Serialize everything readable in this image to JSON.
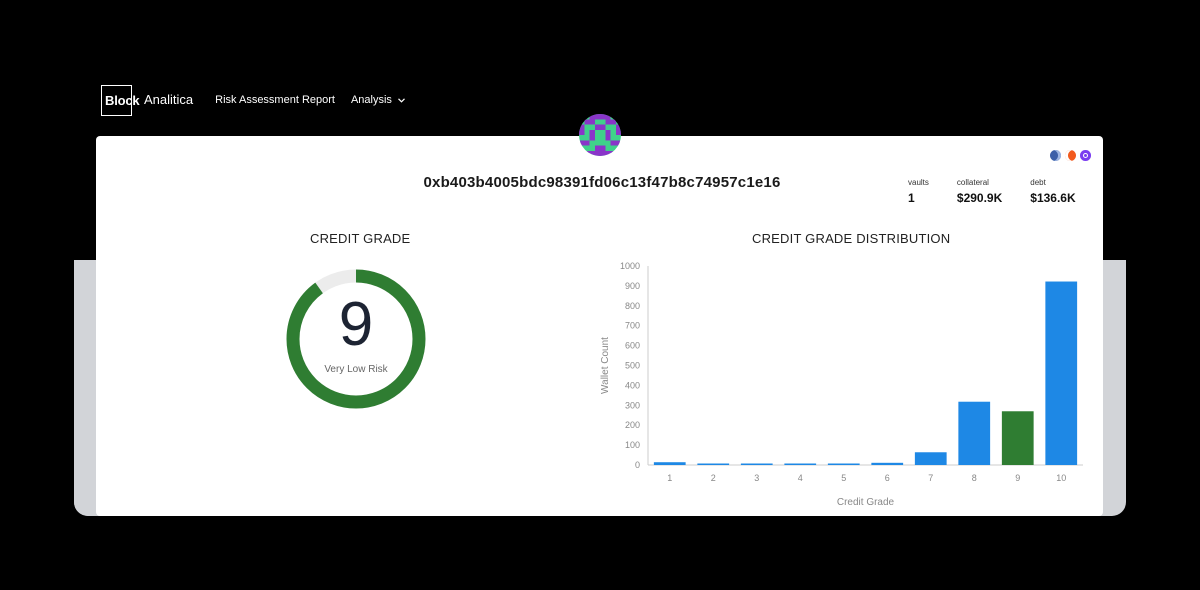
{
  "nav": {
    "logo_bold": "Block",
    "logo_light": "Analitica",
    "links": [
      "Risk Assessment Report",
      "Analysis"
    ]
  },
  "wallet": {
    "address": "0xb403b4005bdc98391fd06c13f47b8c74957c1e16",
    "stats": [
      {
        "label": "vaults",
        "value": "1"
      },
      {
        "label": "collateral",
        "value": "$290.9K"
      },
      {
        "label": "debt",
        "value": "$136.6K"
      }
    ]
  },
  "credit_grade": {
    "title": "CREDIT GRADE",
    "value": "9",
    "max": 10,
    "risk_label": "Very Low Risk"
  },
  "distribution_title": "CREDIT GRADE DISTRIBUTION",
  "colors": {
    "accent_green": "#2f7d32",
    "bar_blue": "#1e88e5",
    "gauge_track": "#ececec"
  },
  "chain_icons": [
    "ethereum-icon",
    "orange-protocol-icon",
    "purple-protocol-icon"
  ],
  "chart_data": {
    "type": "bar",
    "title": "CREDIT GRADE DISTRIBUTION",
    "xlabel": "Credit Grade",
    "ylabel": "Wallet Count",
    "categories": [
      "1",
      "2",
      "3",
      "4",
      "5",
      "6",
      "7",
      "8",
      "9",
      "10"
    ],
    "values": [
      14,
      3,
      2,
      1,
      7,
      11,
      64,
      318,
      270,
      922
    ],
    "highlight_category": "9",
    "ylim": [
      0,
      1000
    ],
    "yticks": [
      0,
      100,
      200,
      300,
      400,
      500,
      600,
      700,
      800,
      900,
      1000
    ],
    "grid": false
  }
}
